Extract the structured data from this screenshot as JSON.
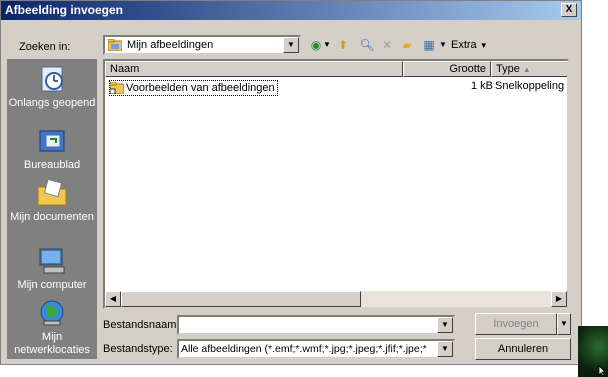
{
  "dialog": {
    "title": "Afbeelding invoegen",
    "close_label": "X"
  },
  "toolbar": {
    "lookin_label": "Zoeken in:",
    "lookin_value": "Mijn afbeeldingen",
    "tools_label": "Extra"
  },
  "places": {
    "items": [
      {
        "label": "Onlangs geopend",
        "icon": "history-icon"
      },
      {
        "label": "Bureaublad",
        "icon": "desktop-icon"
      },
      {
        "label": "Mijn documenten",
        "icon": "my-documents-icon"
      },
      {
        "label": "Mijn computer",
        "icon": "my-computer-icon"
      },
      {
        "label": "Mijn netwerklocaties",
        "icon": "network-places-icon"
      }
    ]
  },
  "files": {
    "columns": {
      "name": "Naam",
      "size": "Grootte",
      "type": "Type"
    },
    "rows": [
      {
        "name": "Voorbeelden van afbeeldingen",
        "size": "1 kB",
        "type": "Snelkoppeling"
      }
    ]
  },
  "form": {
    "filename_label": "Bestandsnaam:",
    "filename_value": "",
    "filetype_label": "Bestandstype:",
    "filetype_value": "Alle afbeeldingen (*.emf;*.wmf;*.jpg;*.jpeg;*.jfif;*.jpe;*",
    "insert_label": "Invoegen",
    "cancel_label": "Annuleren"
  },
  "colors": {
    "title_start": "#0a246a",
    "title_end": "#a6caf0",
    "dialog_bg": "#d4d0c8",
    "places_bg": "#808080"
  }
}
